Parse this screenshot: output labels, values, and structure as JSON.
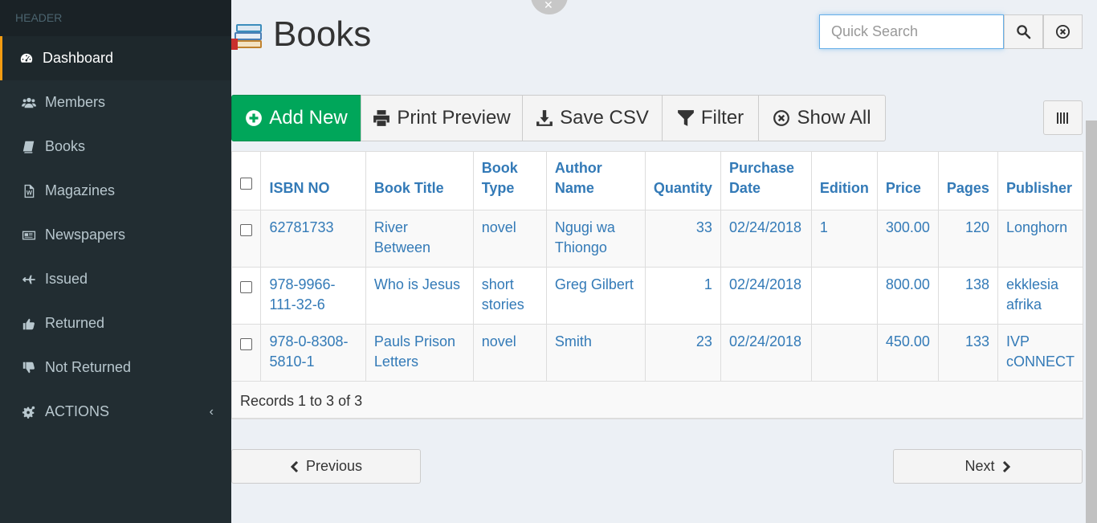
{
  "sidebar": {
    "header": "HEADER",
    "items": [
      {
        "label": "Dashboard",
        "icon": "dashboard-icon",
        "active": true
      },
      {
        "label": "Members",
        "icon": "users-icon"
      },
      {
        "label": "Books",
        "icon": "book-icon"
      },
      {
        "label": "Magazines",
        "icon": "word-file-icon"
      },
      {
        "label": "Newspapers",
        "icon": "newspaper-icon"
      },
      {
        "label": "Issued",
        "icon": "plane-icon"
      },
      {
        "label": "Returned",
        "icon": "thumbs-up-icon"
      },
      {
        "label": "Not Returned",
        "icon": "thumbs-down-icon"
      },
      {
        "label": "ACTIONS",
        "icon": "cogs-icon",
        "chevron": "‹"
      }
    ]
  },
  "page": {
    "title": "Books"
  },
  "search": {
    "placeholder": "Quick Search",
    "value": ""
  },
  "toolbar": {
    "add_new": "Add New",
    "print_preview": "Print Preview",
    "save_csv": "Save CSV",
    "filter": "Filter",
    "show_all": "Show All"
  },
  "table": {
    "headers": [
      "ISBN NO",
      "Book Title",
      "Book Type",
      "Author Name",
      "Quantity",
      "Purchase Date",
      "Edition",
      "Price",
      "Pages",
      "Publisher"
    ],
    "rows": [
      [
        "62781733",
        "River Between",
        "novel",
        "Ngugi wa Thiongo",
        "33",
        "02/24/2018",
        "1",
        "300.00",
        "120",
        "Longhorn"
      ],
      [
        "978-9966-111-32-6",
        "Who is Jesus",
        "short stories",
        "Greg Gilbert",
        "1",
        "02/24/2018",
        "",
        "800.00",
        "138",
        "ekklesia afrika"
      ],
      [
        "978-0-8308-5810-1",
        "Pauls Prison Letters",
        "novel",
        "Smith",
        "23",
        "02/24/2018",
        "",
        "450.00",
        "133",
        "IVP cONNECT"
      ]
    ],
    "records": "Records 1 to 3 of 3"
  },
  "pager": {
    "previous": "Previous",
    "next": "Next"
  },
  "colors": {
    "sidebar": "#222d32",
    "accent": "#f39c12",
    "primary_btn": "#00a65a",
    "link": "#337ab7"
  }
}
